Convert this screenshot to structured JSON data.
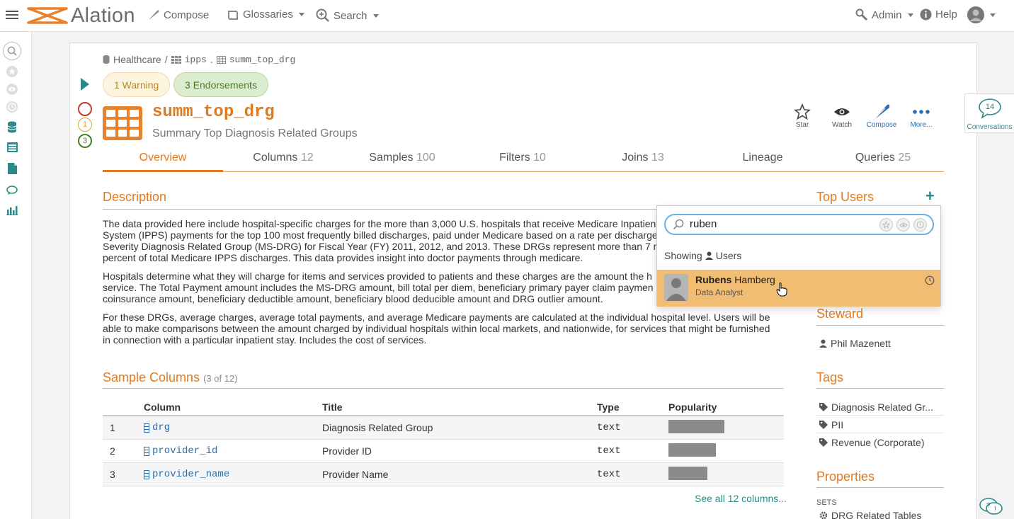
{
  "nav": {
    "brand": "Alation",
    "compose": "Compose",
    "glossaries": "Glossaries",
    "search": "Search",
    "admin": "Admin",
    "help": "Help"
  },
  "breadcrumb": {
    "datasource": "Healthcare",
    "sep1": "/",
    "schema": "ipps",
    "sep2": ".",
    "table": "summ_top_drg"
  },
  "badges": {
    "warning": "1 Warning",
    "endorsements": "3 Endorsements",
    "warn_count": "1",
    "endorse_count": "3"
  },
  "object": {
    "title": "summ_top_drg",
    "subtitle": "Summary Top Diagnosis Related Groups"
  },
  "actions": {
    "star": "Star",
    "watch": "Watch",
    "compose": "Compose",
    "more": "More..."
  },
  "conversations": {
    "count": "14",
    "label": "Conversations"
  },
  "tabs": [
    {
      "label": "Overview",
      "count": ""
    },
    {
      "label": "Columns",
      "count": "12"
    },
    {
      "label": "Samples",
      "count": "100"
    },
    {
      "label": "Filters",
      "count": "10"
    },
    {
      "label": "Joins",
      "count": "13"
    },
    {
      "label": "Lineage",
      "count": ""
    },
    {
      "label": "Queries",
      "count": "25"
    }
  ],
  "description": {
    "heading": "Description",
    "p1_lines": [
      "The data provided here include hospital-specific charges for the more than 3,000 U.S. hospitals that receive Medicare Inpatient",
      "System (IPPS) payments for the top 100 most frequently billed discharges, paid under Medicare based on a rate per discharge",
      "Severity Diagnosis Related Group (MS-DRG) for Fiscal Year (FY) 2011, 2012, and 2013. These DRGs represent more than 7 m",
      "percent of total Medicare IPPS discharges. This data provides insight into doctor payments through medicare."
    ],
    "p2_lines": [
      "Hospitals determine what they will charge for items and services provided to patients and these charges are the amount the h",
      "service. The Total Payment amount includes the MS-DRG amount, bill total per diem, beneficiary primary payer claim paymen",
      "coinsurance amount, beneficiary deductible amount, beneficiary blood deducible amount and DRG outlier amount."
    ],
    "p3_lines": [
      "For these DRGs, average charges, average total payments, and average Medicare payments are calculated at the individual hospital level. Users will be",
      "able to make comparisons between the amount charged by individual hospitals within local markets, and nationwide, for services that might be furnished",
      "in connection with a particular inpatient stay. Includes the cost of services."
    ]
  },
  "sample_columns": {
    "heading": "Sample Columns",
    "count_note": "(3 of 12)",
    "headers": [
      "Column",
      "Title",
      "Type",
      "Popularity"
    ],
    "rows": [
      {
        "num": "1",
        "column": "drg",
        "title": "Diagnosis Related Group",
        "type": "text",
        "popularity": 1.0
      },
      {
        "num": "2",
        "column": "provider_id",
        "title": "Provider ID",
        "type": "text",
        "popularity": 0.85
      },
      {
        "num": "3",
        "column": "provider_name",
        "title": "Provider Name",
        "type": "text",
        "popularity": 0.69
      }
    ],
    "see_all": "See all 12 columns..."
  },
  "top_users": {
    "heading": "Top Users",
    "add": "+"
  },
  "steward": {
    "heading": "Steward",
    "name": "Phil Mazenett"
  },
  "tags": {
    "heading": "Tags",
    "items": [
      "Diagnosis Related Gr...",
      "PII",
      "Revenue (Corporate)"
    ]
  },
  "properties": {
    "heading": "Properties",
    "sets_label": "SETS",
    "first_set": "DRG Related Tables"
  },
  "dropdown": {
    "query": "ruben",
    "showing": "Showing",
    "showing_type": "Users",
    "result_first": "Rubens",
    "result_last": "Hamberg",
    "result_role": "Data Analyst"
  },
  "colors": {
    "accent": "#e07a1f",
    "teal": "#2a8a87",
    "highlight": "#f0bd72"
  }
}
